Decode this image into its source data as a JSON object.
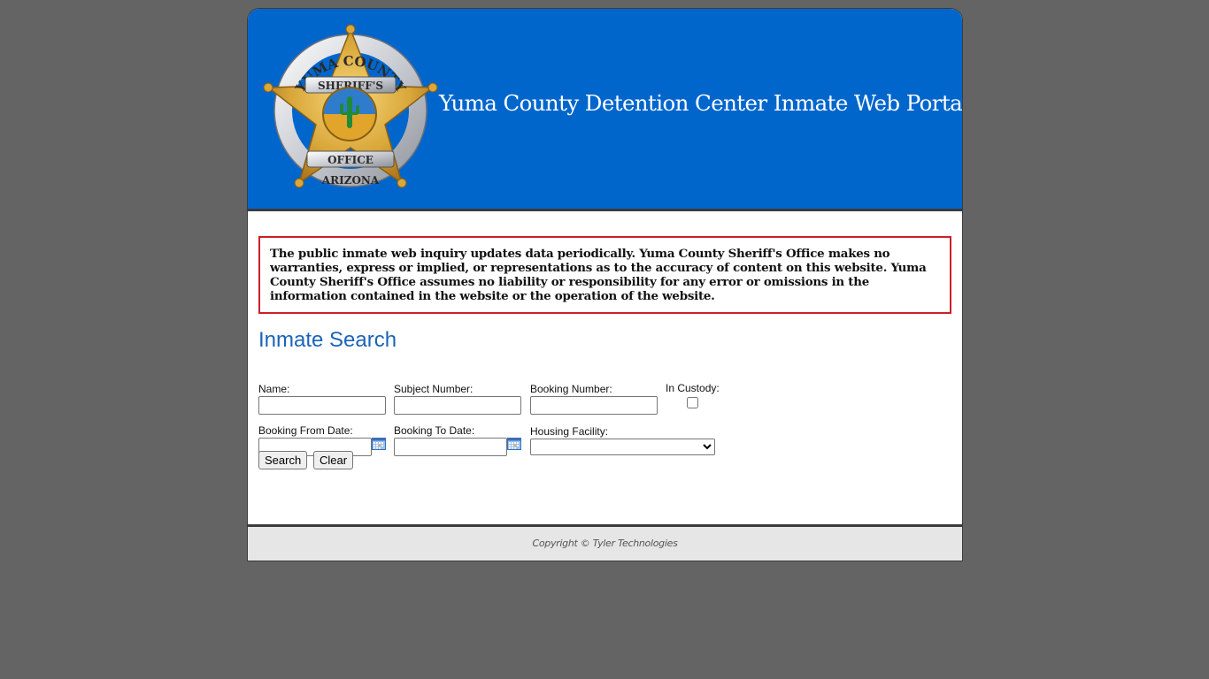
{
  "header": {
    "logo_text": {
      "top": "YUMA COUNTY",
      "banner_top": "SHERIFF'S",
      "banner_bottom": "OFFICE",
      "bottom": "ARIZONA"
    },
    "title": "Yuma County Detention Center Inmate Web Portal"
  },
  "disclaimer": "The public inmate web inquiry updates data periodically. Yuma County Sheriff's Office makes no warranties, express or implied, or representations as to the accuracy of content on this website. Yuma County Sheriff's Office assumes no liability or responsibility for any error or omissions in the information contained in the website or the operation of the website.",
  "search": {
    "title": "Inmate Search",
    "fields": {
      "name": {
        "label": "Name:",
        "value": ""
      },
      "subject_number": {
        "label": "Subject Number:",
        "value": ""
      },
      "booking_number": {
        "label": "Booking Number:",
        "value": ""
      },
      "in_custody": {
        "label": "In Custody:",
        "checked": false
      },
      "booking_from_date": {
        "label": "Booking From Date:",
        "value": ""
      },
      "booking_to_date": {
        "label": "Booking To Date:",
        "value": ""
      },
      "housing_facility": {
        "label": "Housing Facility:",
        "selected": ""
      }
    },
    "buttons": {
      "search": "Search",
      "clear": "Clear"
    }
  },
  "footer": {
    "copyright": "Copyright © Tyler Technologies"
  },
  "colors": {
    "header_blue": "#0066cc",
    "title_blue": "#1a64b8",
    "disclaimer_border": "#cc1f28",
    "page_background": "#646464"
  }
}
